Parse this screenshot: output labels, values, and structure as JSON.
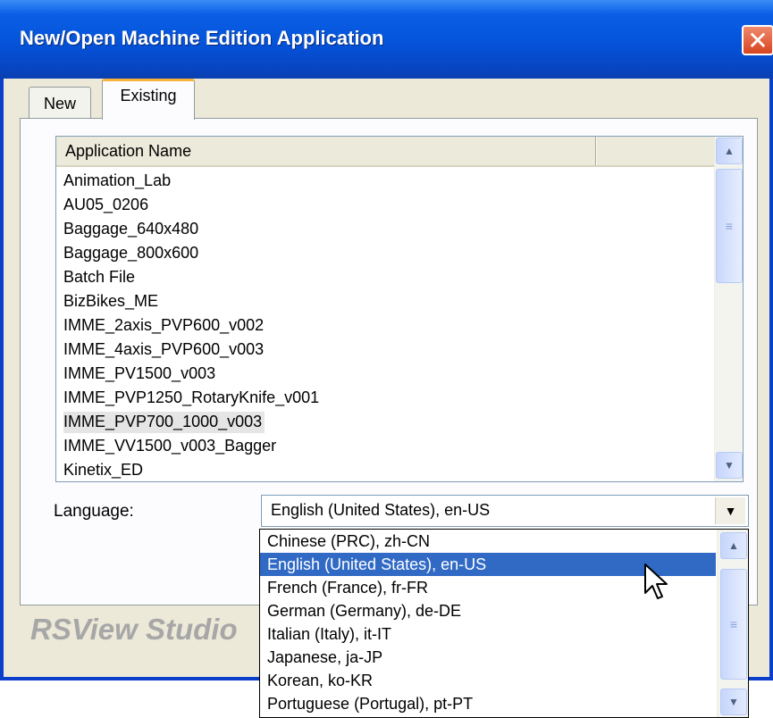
{
  "window": {
    "title": "New/Open Machine Edition Application",
    "close_glyph": "✕"
  },
  "tabs": [
    {
      "label": "New",
      "selected": false
    },
    {
      "label": "Existing",
      "selected": true
    }
  ],
  "app_list": {
    "columns": [
      "Application Name",
      ""
    ],
    "rows": [
      "Animation_Lab",
      "AU05_0206",
      "Baggage_640x480",
      "Baggage_800x600",
      "Batch File",
      "BizBikes_ME",
      "IMME_2axis_PVP600_v002",
      "IMME_4axis_PVP600_v003",
      "IMME_PV1500_v003",
      "IMME_PVP1250_RotaryKnife_v001",
      "IMME_PVP700_1000_v003",
      "IMME_VV1500_v003_Bagger",
      "Kinetix_ED"
    ],
    "selected_row": "IMME_PVP700_1000_v003"
  },
  "language": {
    "label": "Language:",
    "value": "English (United States), en-US",
    "options": [
      "Chinese (PRC), zh-CN",
      "English (United States), en-US",
      "French (France), fr-FR",
      "German (Germany), de-DE",
      "Italian (Italy), it-IT",
      "Japanese, ja-JP",
      "Korean, ko-KR",
      "Portuguese (Portugal), pt-PT"
    ],
    "highlighted_option": "English (United States), en-US"
  },
  "watermark": "RSView Studio",
  "icons": {
    "scroll_up": "▲",
    "scroll_down": "▼",
    "grip": "≡",
    "dropdown": "▼"
  },
  "colors": {
    "titlebar": "#0553d9",
    "selection": "#316ac5",
    "tab_accent": "#f8b33a"
  }
}
